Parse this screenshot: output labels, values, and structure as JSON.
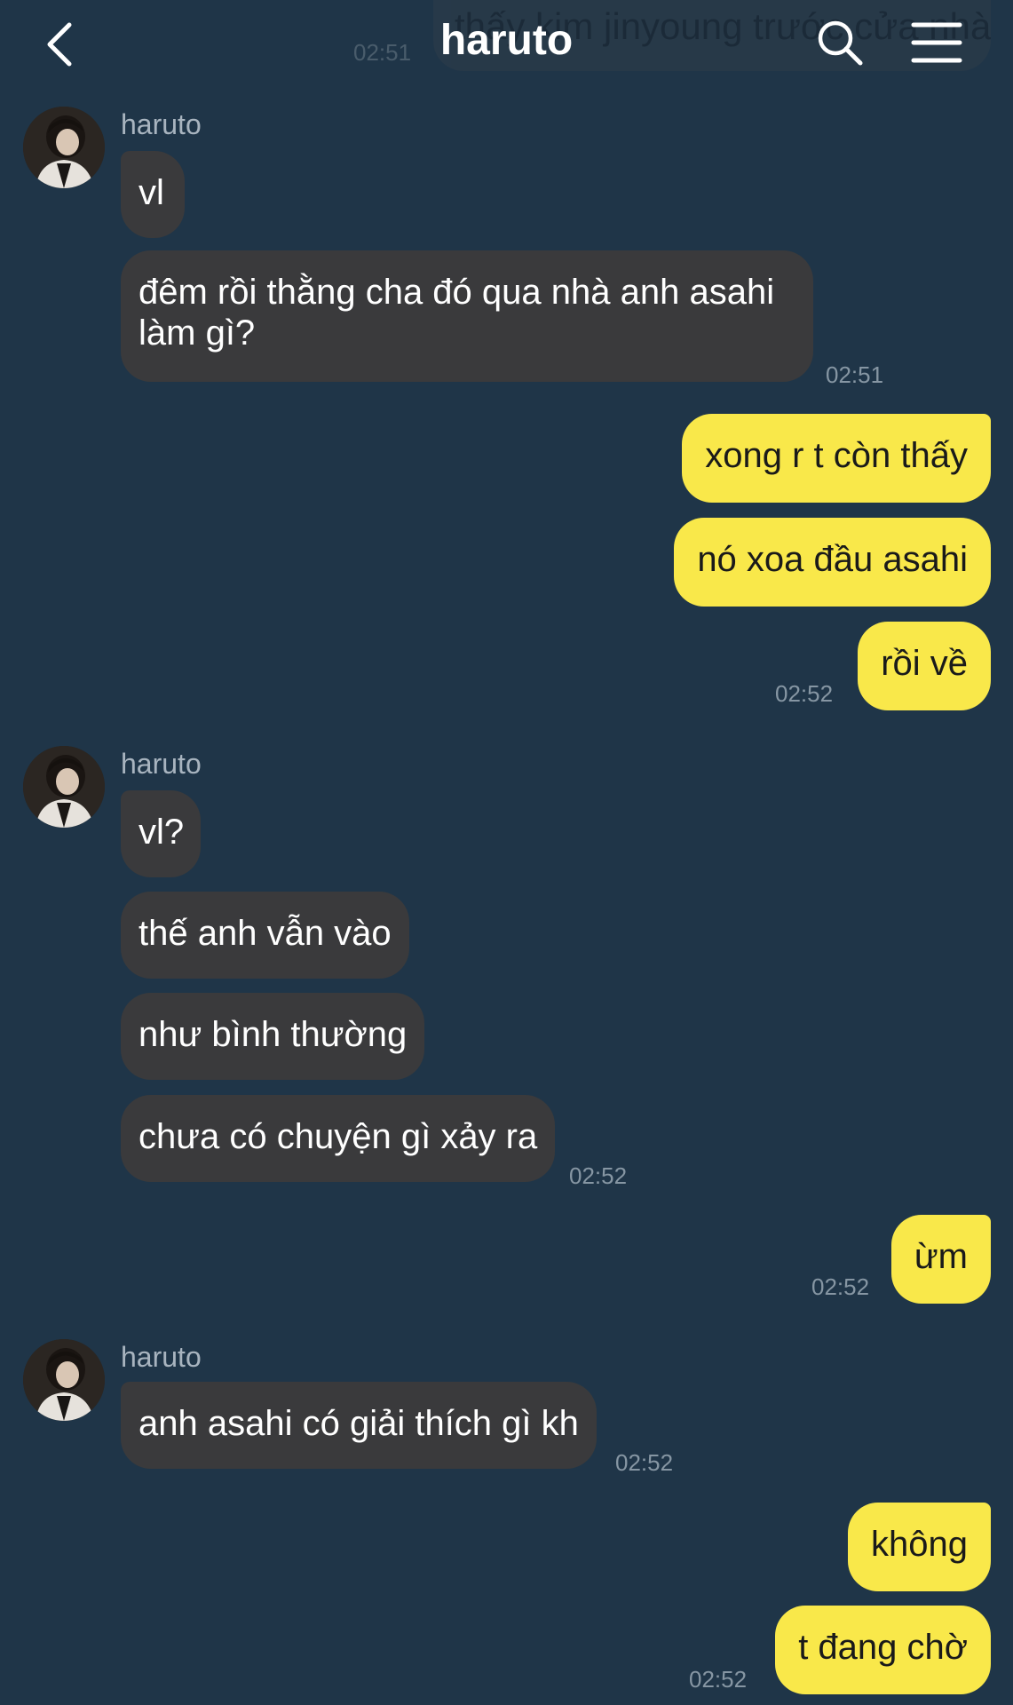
{
  "header": {
    "title": "haruto",
    "prev_message_fragment": "thấy kim jinyoung trước cửa nhà",
    "prev_message_time": "02:51",
    "icons": [
      "back-arrow-icon",
      "search-icon",
      "hamburger-menu-icon"
    ]
  },
  "colors": {
    "background": "#1f3548",
    "incoming_bubble": "#3a3a3c",
    "outgoing_bubble": "#f9e84a",
    "timestamp": "#8696a3",
    "sender_name": "#a8b4bf"
  },
  "chat": {
    "groups": [
      {
        "sender": "haruto",
        "messages": [
          "vl",
          "đêm rồi thằng cha đó qua nhà anh asahi làm gì?"
        ],
        "time": "02:51"
      },
      {
        "sender": "me",
        "messages": [
          "xong r t còn thấy",
          "nó xoa đầu asahi",
          "rồi về"
        ],
        "time": "02:52"
      },
      {
        "sender": "haruto",
        "messages": [
          "vl?",
          "thế anh vẫn vào",
          "như bình thường",
          "chưa có chuyện gì xảy ra"
        ],
        "time": "02:52"
      },
      {
        "sender": "me",
        "messages": [
          "ừm"
        ],
        "time": "02:52"
      },
      {
        "sender": "haruto",
        "messages": [
          "anh asahi có giải thích gì kh"
        ],
        "time": "02:52"
      },
      {
        "sender": "me",
        "messages": [
          "không",
          "t đang chờ"
        ],
        "time": "02:52"
      }
    ]
  }
}
